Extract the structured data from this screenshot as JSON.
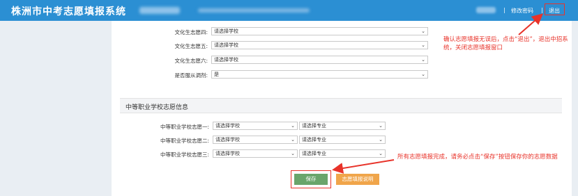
{
  "header": {
    "title": "株洲市中考志愿填报系统",
    "change_password": "修改密码",
    "logout": "退出"
  },
  "culture": {
    "rows": [
      {
        "label": "文化生志愿四:",
        "value": "请选择学校"
      },
      {
        "label": "文化生志愿五:",
        "value": "请选择学校"
      },
      {
        "label": "文化生志愿六:",
        "value": "请选择学校"
      },
      {
        "label": "是否服从调剂:",
        "value": "是"
      }
    ]
  },
  "vocational": {
    "section_title": "中等职业学校志愿信息",
    "rows": [
      {
        "label": "中等职业学校志愿一:",
        "school": "请选择学校",
        "major": "请选择专业"
      },
      {
        "label": "中等职业学校志愿二:",
        "school": "请选择学校",
        "major": "请选择专业"
      },
      {
        "label": "中等职业学校志愿三:",
        "school": "请选择学校",
        "major": "请选择专业"
      }
    ]
  },
  "buttons": {
    "save": "保存",
    "help": "志愿填报说明"
  },
  "annotations": {
    "logout_note": "确认志愿填报无误后，点击“退出”，退出中招系统，关闭志愿填报窗口",
    "save_note": "所有志愿填报完成，请务必点击“保存”按钮保存你的志愿数据"
  },
  "colors": {
    "header": "#2b8fd3",
    "annotation": "#e8332a",
    "save_button": "#6aa56b",
    "help_button": "#f0a54a"
  }
}
